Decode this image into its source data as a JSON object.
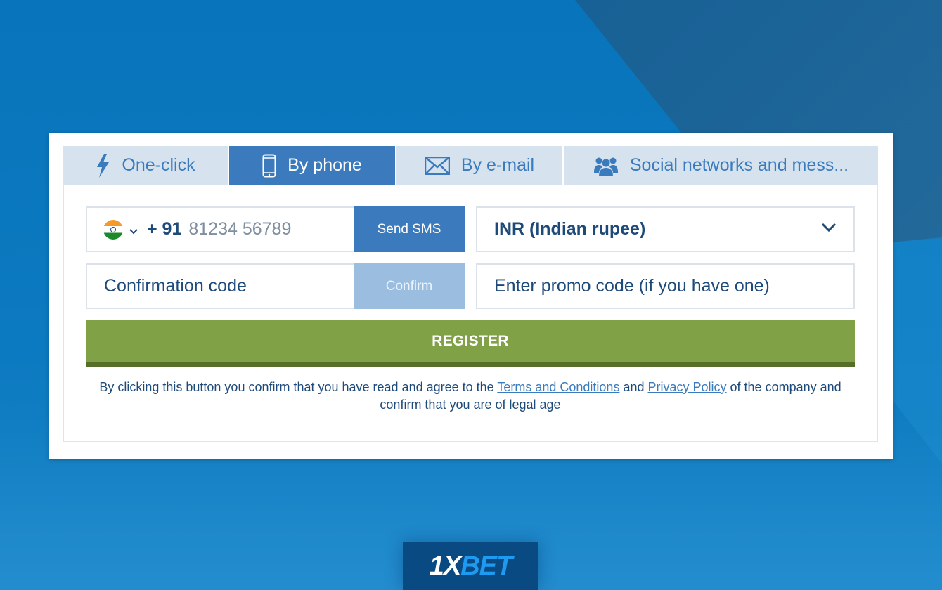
{
  "tabs": [
    {
      "label": "One-click",
      "icon": "lightning-icon",
      "active": false
    },
    {
      "label": "By phone",
      "icon": "mobile-phone-icon",
      "active": true
    },
    {
      "label": "By e-mail",
      "icon": "envelope-icon",
      "active": false
    },
    {
      "label": "Social networks and mess...",
      "icon": "users-icon",
      "active": false
    }
  ],
  "form": {
    "phone": {
      "country_flag": "india-flag",
      "country_code": "+ 91",
      "placeholder": "81234 56789",
      "send_sms_label": "Send SMS"
    },
    "currency": {
      "selected": "INR (Indian rupee)"
    },
    "confirmation": {
      "placeholder": "Confirmation code",
      "confirm_label": "Confirm"
    },
    "promo": {
      "placeholder": "Enter promo code (if you have one)"
    },
    "register_label": "REGISTER",
    "legal": {
      "text_before": "By clicking this button you confirm that you have read and agree to the ",
      "terms_link": "Terms and Conditions",
      "text_and": " and ",
      "privacy_link": "Privacy Policy",
      "text_after": " of the company and confirm that you are of legal age"
    }
  },
  "brand": {
    "logo_part1": "1X",
    "logo_part2": "BET"
  },
  "colors": {
    "primary_blue": "#3b7bbd",
    "tab_background": "#d6e3ef",
    "register_green": "#80a146",
    "text_dark": "#1e4a7a",
    "page_background": "#0a76bd"
  }
}
